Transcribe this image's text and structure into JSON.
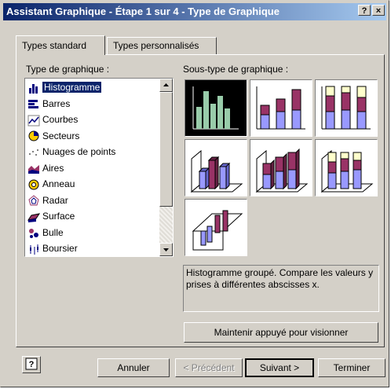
{
  "window": {
    "title": "Assistant Graphique - Étape 1 sur 4 - Type de Graphique",
    "help_label": "?",
    "close_label": "×"
  },
  "tabs": [
    {
      "label": "Types standard"
    },
    {
      "label": "Types personnalisés"
    }
  ],
  "chart_type": {
    "label": "Type de graphique :",
    "items": [
      {
        "label": "Histogramme",
        "icon": "column-chart-icon",
        "selected": true
      },
      {
        "label": "Barres",
        "icon": "bar-chart-icon"
      },
      {
        "label": "Courbes",
        "icon": "line-chart-icon"
      },
      {
        "label": "Secteurs",
        "icon": "pie-chart-icon"
      },
      {
        "label": "Nuages de points",
        "icon": "scatter-chart-icon"
      },
      {
        "label": "Aires",
        "icon": "area-chart-icon"
      },
      {
        "label": "Anneau",
        "icon": "doughnut-chart-icon"
      },
      {
        "label": "Radar",
        "icon": "radar-chart-icon"
      },
      {
        "label": "Surface",
        "icon": "surface-chart-icon"
      },
      {
        "label": "Bulle",
        "icon": "bubble-chart-icon"
      },
      {
        "label": "Boursier",
        "icon": "stock-chart-icon"
      }
    ]
  },
  "subtype": {
    "label": "Sous-type de graphique :",
    "options": [
      {
        "name": "clustered-column",
        "selected": true
      },
      {
        "name": "stacked-column"
      },
      {
        "name": "100-stacked-column"
      },
      {
        "name": "3d-clustered-column"
      },
      {
        "name": "3d-stacked-column"
      },
      {
        "name": "3d-100-stacked-column"
      },
      {
        "name": "3d-column"
      }
    ],
    "description": "Histogramme groupé. Compare les valeurs y prises à différentes abscisses x."
  },
  "preview_button": "Maintenir appuyé pour visionner",
  "footer": {
    "help_icon": "help-icon",
    "cancel": "Annuler",
    "previous": "< Précédent",
    "next": "Suivant >",
    "finish": "Terminer"
  },
  "colors": {
    "series1": "#9999ff",
    "series2": "#993366",
    "series3": "#ffffcc",
    "selected_bar": "#99ccaa",
    "title_bar": "#0a246a"
  }
}
